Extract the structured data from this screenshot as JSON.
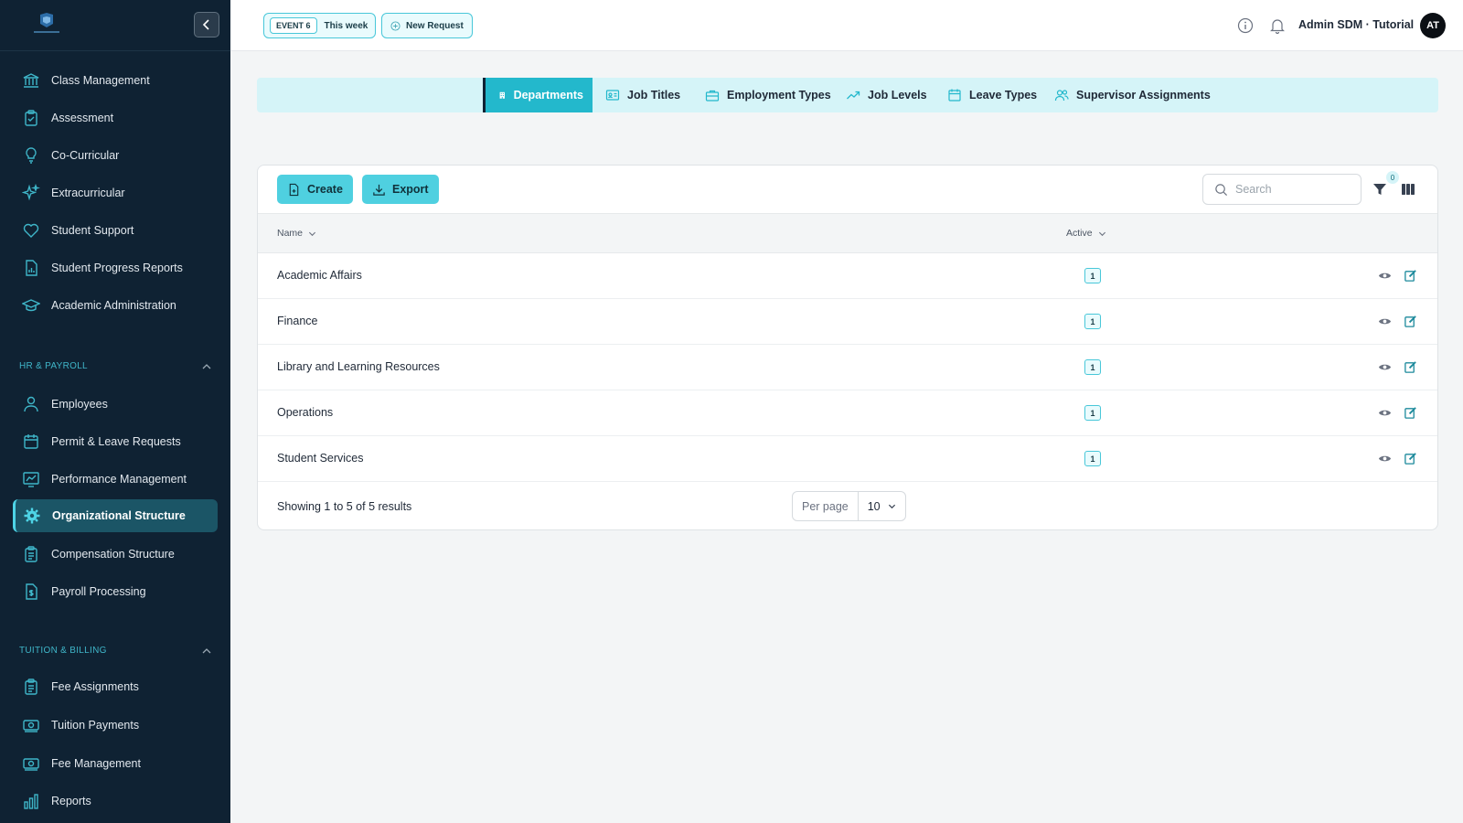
{
  "sidebar": {
    "main_items": [
      {
        "label": "Class Management",
        "icon": "building-columns-icon"
      },
      {
        "label": "Assessment",
        "icon": "clipboard-check-icon"
      },
      {
        "label": "Co-Curricular",
        "icon": "lightbulb-icon"
      },
      {
        "label": "Extracurricular",
        "icon": "sparkles-icon"
      },
      {
        "label": "Student Support",
        "icon": "heart-icon"
      },
      {
        "label": "Student Progress Reports",
        "icon": "document-chart-icon"
      },
      {
        "label": "Academic Administration",
        "icon": "graduation-cap-icon"
      }
    ],
    "hr_section": {
      "title": "HR & PAYROLL",
      "items": [
        {
          "label": "Employees",
          "icon": "user-icon"
        },
        {
          "label": "Permit & Leave Requests",
          "icon": "calendar-icon"
        },
        {
          "label": "Performance Management",
          "icon": "chart-line-icon"
        },
        {
          "label": "Organizational Structure",
          "icon": "gear-icon",
          "active": true
        },
        {
          "label": "Compensation Structure",
          "icon": "clipboard-list-icon"
        },
        {
          "label": "Payroll Processing",
          "icon": "document-dollar-icon"
        }
      ]
    },
    "billing_section": {
      "title": "TUITION & BILLING",
      "items": [
        {
          "label": "Fee Assignments",
          "icon": "clipboard-list-icon"
        },
        {
          "label": "Tuition Payments",
          "icon": "cash-icon"
        },
        {
          "label": "Fee Management",
          "icon": "cash-icon"
        },
        {
          "label": "Reports",
          "icon": "bar-chart-icon"
        }
      ]
    }
  },
  "header": {
    "event_tag": "EVENT 6",
    "event_text": "This week",
    "new_request": "New Request",
    "user_name": "Admin SDM · Tutorial",
    "avatar_initials": "AT"
  },
  "tabs": [
    {
      "label": "Departments",
      "icon": "building-icon",
      "active": true
    },
    {
      "label": "Job Titles",
      "icon": "id-card-icon"
    },
    {
      "label": "Employment Types",
      "icon": "briefcase-icon"
    },
    {
      "label": "Job Levels",
      "icon": "trending-up-icon"
    },
    {
      "label": "Leave Types",
      "icon": "calendar-icon"
    },
    {
      "label": "Supervisor Assignments",
      "icon": "users-icon"
    }
  ],
  "toolbar": {
    "create_label": "Create",
    "export_label": "Export",
    "search_placeholder": "Search",
    "filter_count": "0"
  },
  "table": {
    "columns": [
      "Name",
      "Active"
    ],
    "rows": [
      {
        "name": "Academic Affairs",
        "active": "1"
      },
      {
        "name": "Finance",
        "active": "1"
      },
      {
        "name": "Library and Learning Resources",
        "active": "1"
      },
      {
        "name": "Operations",
        "active": "1"
      },
      {
        "name": "Student Services",
        "active": "1"
      }
    ]
  },
  "footer": {
    "results_text": "Showing 1 to 5 of 5 results",
    "per_page_label": "Per page",
    "per_page_value": "10"
  },
  "colors": {
    "sidebar_bg": "#0f2233",
    "accent": "#23b8cc",
    "button": "#4fd0e0",
    "tabbar_bg": "#d5f4f8"
  }
}
